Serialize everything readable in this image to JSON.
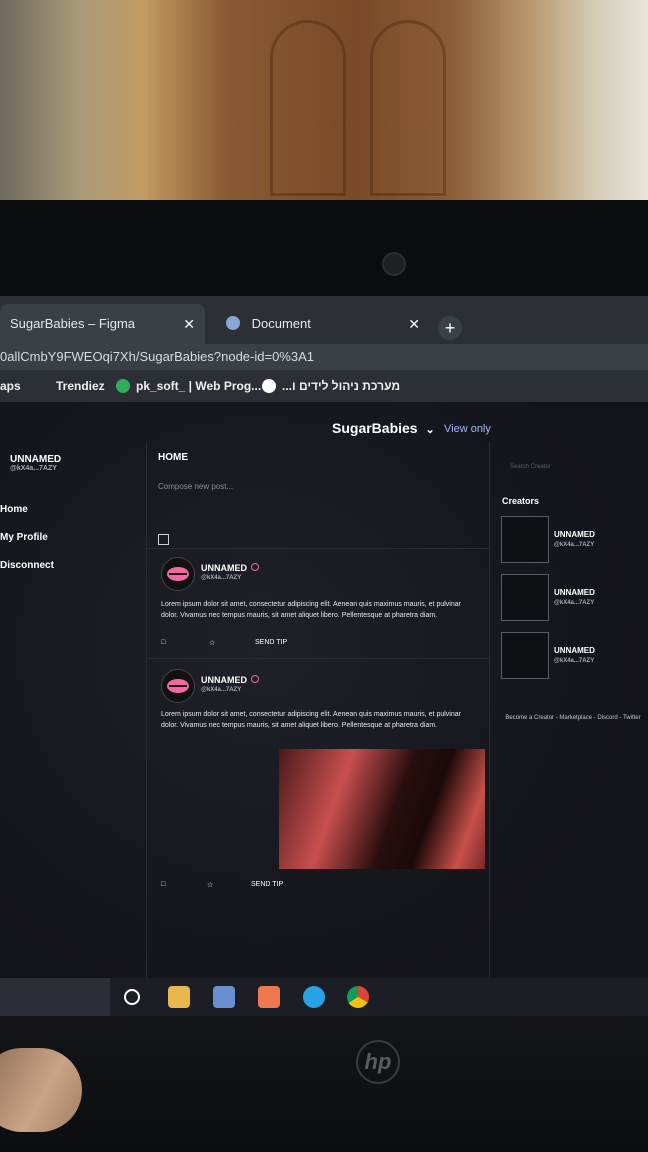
{
  "browser": {
    "tabs": [
      {
        "label": "SugarBabies – Figma",
        "close": "✕"
      },
      {
        "label": "Document",
        "close": "✕"
      }
    ],
    "new_tab": "+",
    "url": "0allCmbY9FWEOqi7Xh/SugarBabies?node-id=0%3A1",
    "bookmarks": [
      "aps",
      "Trendiez",
      "pk_soft_ | Web Prog...",
      "...מערכת ניהול לידים ו"
    ]
  },
  "figma": {
    "file_name": "SugarBabies",
    "dropdown": "⌄",
    "view_mode": "View only"
  },
  "app": {
    "sidebar": {
      "user_name": "UNNAMED",
      "user_handle": "@kX4a...7AZY",
      "nav": [
        "Home",
        "My Profile",
        "Disconnect"
      ]
    },
    "feed": {
      "title": "HOME",
      "compose_placeholder": "Compose new post...",
      "posts": [
        {
          "name": "UNNAMED",
          "handle": "@kX4a...7AZY",
          "text": "Lorem ipsum dolor sit amet, consectetur adipiscing elit. Aenean quis maximus mauris, et pulvinar dolor. Vivamus nec tempus mauris, sit amet aliquet libero. Pellentesque at pharetra diam.",
          "send_tip": "SEND TIP"
        },
        {
          "name": "UNNAMED",
          "handle": "@kX4a...7AZY",
          "text": "Lorem ipsum dolor sit amet, consectetur adipiscing elit. Aenean quis maximus mauris, et pulvinar dolor. Vivamus nec tempus mauris, sit amet aliquet libero. Pellentesque at pharetra diam.",
          "send_tip": "SEND TIP"
        }
      ]
    },
    "right": {
      "search_placeholder": "Search Creator",
      "creators_title": "Creators",
      "creators": [
        {
          "name": "UNNAMED",
          "handle": "@kX4a...7AZY"
        },
        {
          "name": "UNNAMED",
          "handle": "@kX4a...7AZY"
        },
        {
          "name": "UNNAMED",
          "handle": "@kX4a...7AZY"
        }
      ],
      "footer": "Become a Creator - Marketplace - Discord - Twitter"
    }
  },
  "device": {
    "logo": "hp"
  },
  "colors": {
    "accent_pink": "#f06aa0",
    "figma_bg": "#131419",
    "tab_active": "#3b3f46",
    "link_blue": "#9fb8ff"
  },
  "icons": [
    "comment-icon",
    "star-icon",
    "image-icon",
    "globe-icon",
    "close-icon",
    "plus-icon",
    "chevron-down-icon",
    "verified-icon"
  ]
}
